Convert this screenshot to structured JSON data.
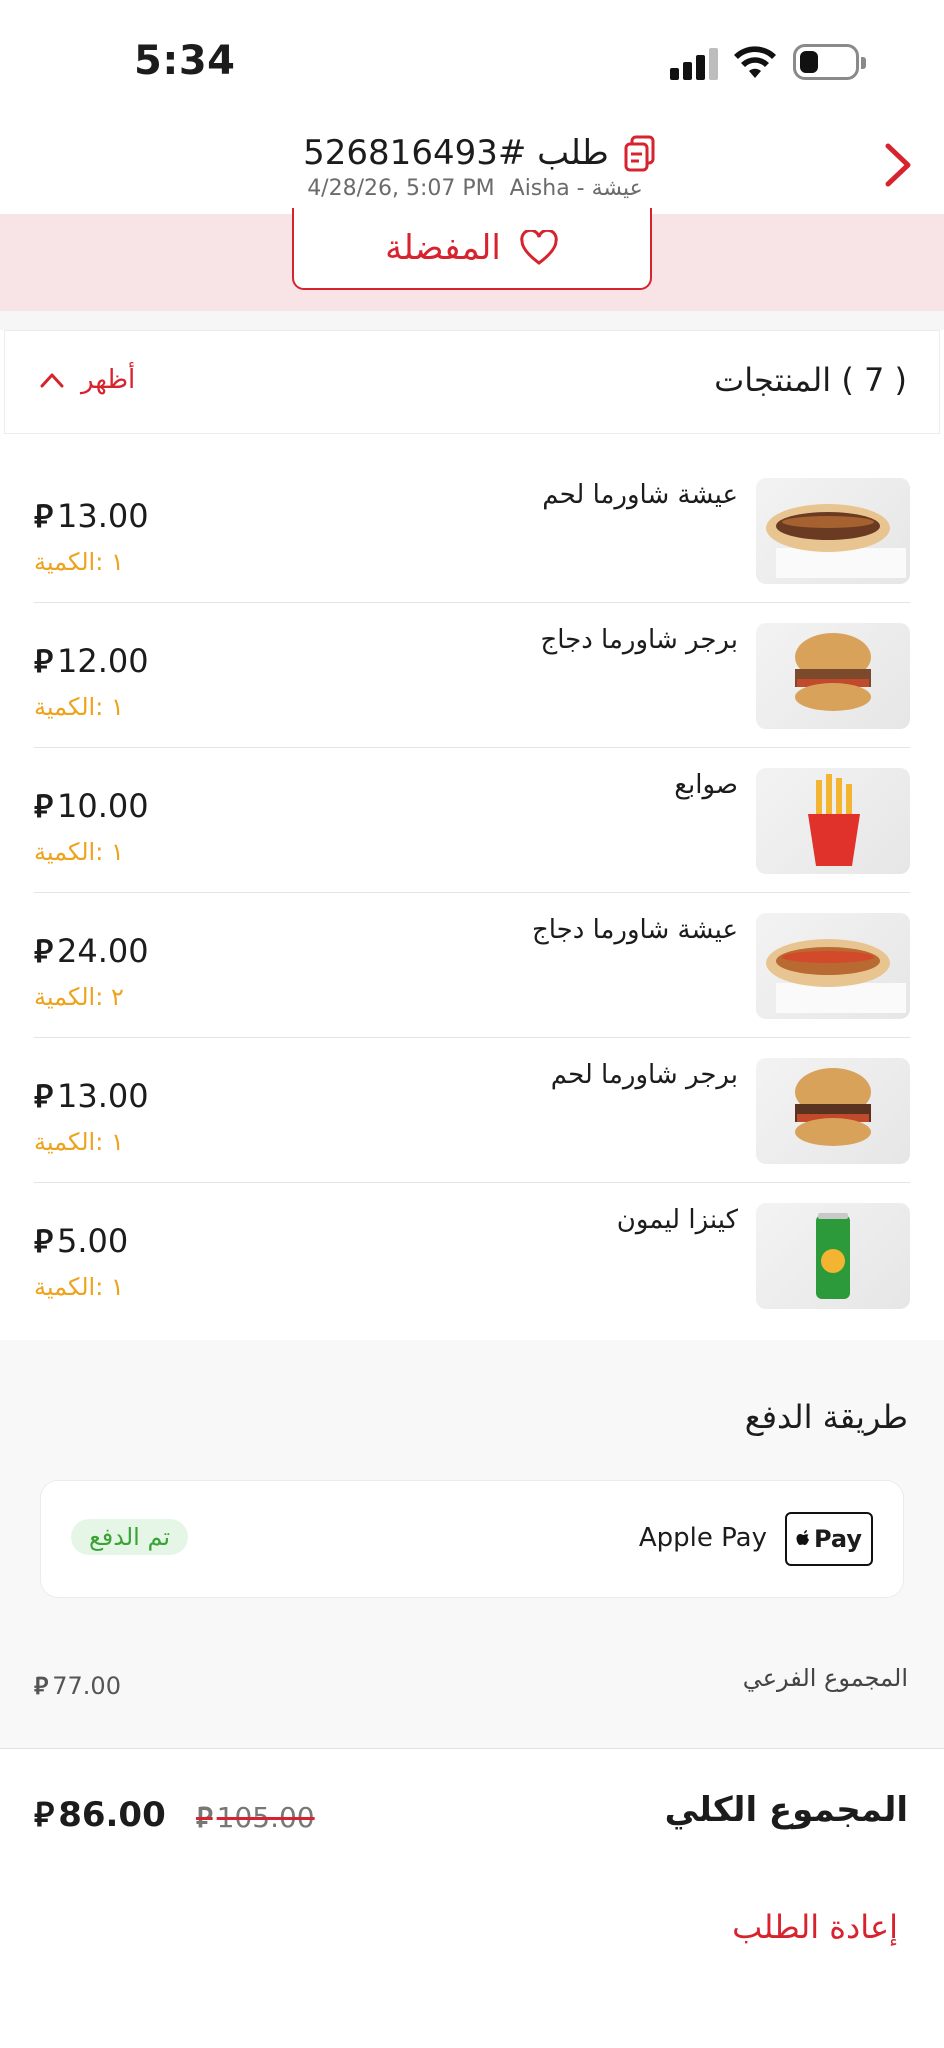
{
  "status_bar": {
    "time": "5:34"
  },
  "header": {
    "order_title": "طلب #526816493",
    "date": "4/28/26, 5:07 PM",
    "restaurant": "Aisha - عيشة"
  },
  "favorite": {
    "label": "المفضلة"
  },
  "products_section": {
    "title": "( 7 ) المنتجات",
    "toggle_label": "أظهر"
  },
  "currency_symbol": "⃁",
  "products": [
    {
      "name": "عيشة شاورما لحم",
      "price": "13.00",
      "qty": "١ :الكمية",
      "image": "wrap"
    },
    {
      "name": "برجر شاورما دجاج",
      "price": "12.00",
      "qty": "١ :الكمية",
      "image": "burger"
    },
    {
      "name": "صوابع",
      "price": "10.00",
      "qty": "١ :الكمية",
      "image": "fries"
    },
    {
      "name": "عيشة شاورما دجاج",
      "price": "24.00",
      "qty": "٢ :الكمية",
      "image": "wrap"
    },
    {
      "name": "برجر شاورما لحم",
      "price": "13.00",
      "qty": "١ :الكمية",
      "image": "burger"
    },
    {
      "name": "كينزا ليمون",
      "price": "5.00",
      "qty": "١ :الكمية",
      "image": "can"
    }
  ],
  "payment": {
    "title": "طريقة الدفع",
    "method": "Apple Pay",
    "logo_text": "Pay",
    "status": "تم الدفع"
  },
  "subtotal": {
    "label": "المجموع الفرعي",
    "value": "77.00"
  },
  "total": {
    "label": "المجموع الكلي",
    "value": "86.00",
    "original": "105.00"
  },
  "reorder_label": "إعادة الطلب",
  "colors": {
    "accent": "#d7232e",
    "qty": "#eda31d",
    "paid_green": "#3aa335",
    "pink_band": "#f8e3e7"
  }
}
